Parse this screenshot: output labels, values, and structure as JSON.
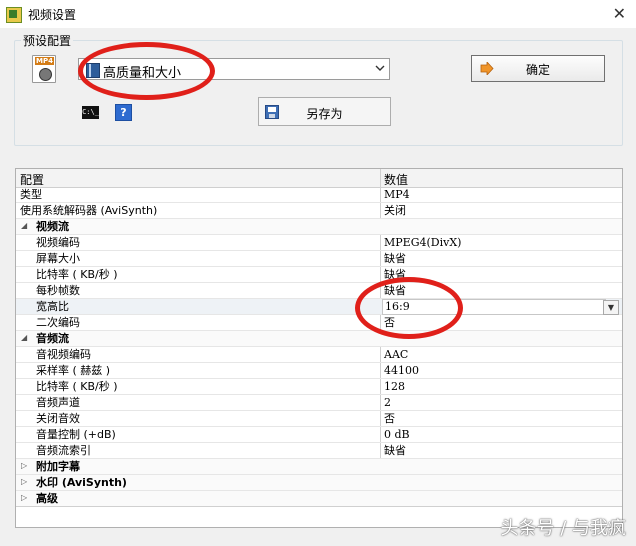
{
  "window": {
    "title": "视频设置",
    "close_glyph": "✕"
  },
  "preset": {
    "group_label": "预设配置",
    "file_icon_text": "MP4",
    "selected": "高质量和大小",
    "ok_label": "确定",
    "save_as_label": "另存为",
    "console_text": "C:\\_",
    "help_text": "?"
  },
  "grid": {
    "header_name": "配置",
    "header_value": "数值",
    "rows": [
      {
        "name": "类型",
        "value": "MP4"
      },
      {
        "name": "使用系统解码器 (AviSynth)",
        "value": "关闭"
      },
      {
        "name": "视频流",
        "category": true,
        "expander": "◢"
      },
      {
        "name": "视频编码",
        "value": "MPEG4(DivX)"
      },
      {
        "name": "屏幕大小",
        "value": "缺省"
      },
      {
        "name": "比特率 ( KB/秒 )",
        "value": "缺省"
      },
      {
        "name": "每秒帧数",
        "value": "缺省"
      },
      {
        "name": "宽高比",
        "value": "16:9",
        "selected": true
      },
      {
        "name": "二次编码",
        "value": "否"
      },
      {
        "name": "音频流",
        "category": true,
        "expander": "◢"
      },
      {
        "name": "音视频编码",
        "value": "AAC"
      },
      {
        "name": "采样率 ( 赫兹 )",
        "value": "44100"
      },
      {
        "name": "比特率 ( KB/秒 )",
        "value": "128"
      },
      {
        "name": "音频声道",
        "value": "2"
      },
      {
        "name": "关闭音效",
        "value": "否"
      },
      {
        "name": "音量控制 (+dB)",
        "value": "0 dB"
      },
      {
        "name": "音频流索引",
        "value": "缺省"
      },
      {
        "name": "附加字幕",
        "category": true,
        "expander": "▷"
      },
      {
        "name": "水印 (AviSynth)",
        "category": true,
        "expander": "▷"
      },
      {
        "name": "高级",
        "category": true,
        "expander": "▷"
      }
    ]
  },
  "watermark": "头条号 / 与我疯",
  "colors": {
    "annotation": "#e0201a",
    "ok_arrow": "#f0952a"
  }
}
